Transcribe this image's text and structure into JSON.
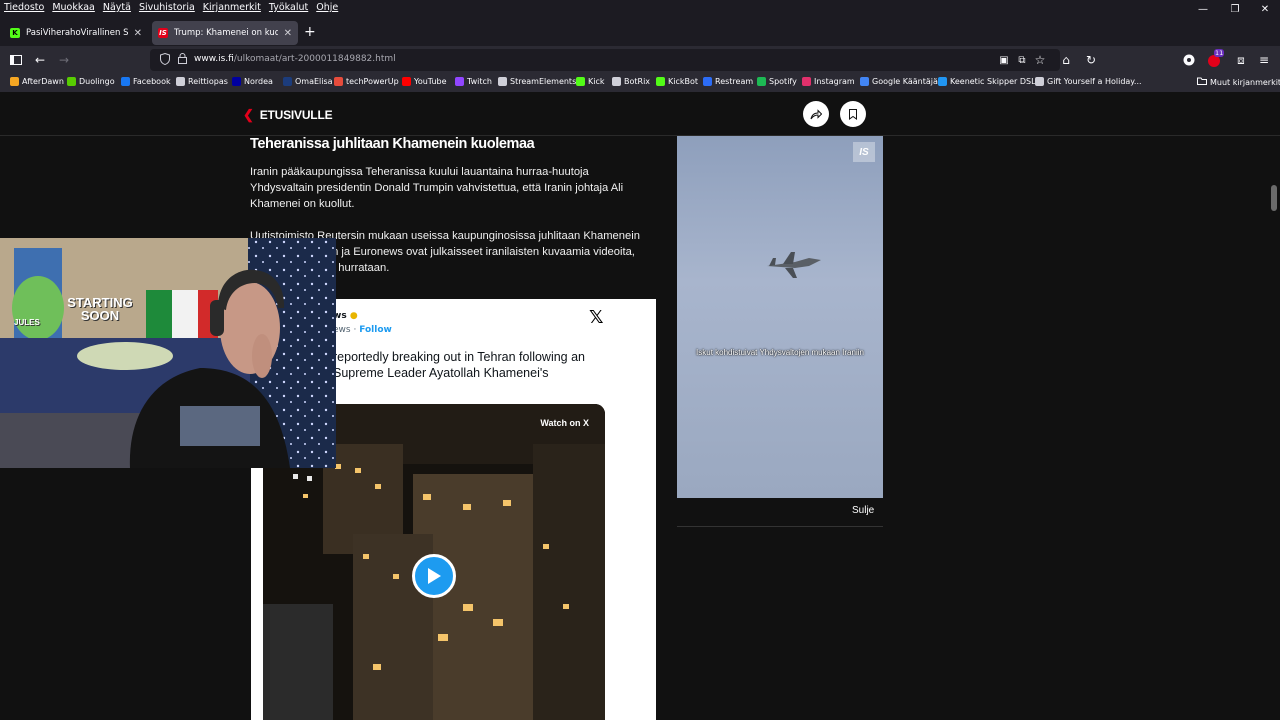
{
  "menu": [
    "Tiedosto",
    "Muokkaa",
    "Näytä",
    "Sivuhistoria",
    "Kirjanmerkit",
    "Työkalut",
    "Ohje"
  ],
  "tabs": [
    {
      "title": "PasiViherahoVirallinen Stream -",
      "favicon_color": "#53fc18"
    },
    {
      "title": "Trump: Khamenei on kuollut - IS",
      "favicon_color": "#e2001a",
      "favicon_text": "IS"
    }
  ],
  "url": {
    "host": "www.is.fi",
    "path": "/ulkomaat/art-2000011849882.html"
  },
  "bookmarks": [
    {
      "label": "AfterDawn",
      "color": "#f5a623"
    },
    {
      "label": "Duolingo",
      "color": "#58cc02"
    },
    {
      "label": "Facebook",
      "color": "#1877f2"
    },
    {
      "label": "Reittiopas",
      "color": "#cfcfd8"
    },
    {
      "label": "Nordea",
      "color": "#0000a0"
    },
    {
      "label": "OmaElisa",
      "color": "#1c3c7c"
    },
    {
      "label": "techPowerUp",
      "color": "#e74c3c"
    },
    {
      "label": "YouTube",
      "color": "#ff0000"
    },
    {
      "label": "Twitch",
      "color": "#9146ff"
    },
    {
      "label": "StreamElements",
      "color": "#cfcfd8"
    },
    {
      "label": "Kick",
      "color": "#53fc18"
    },
    {
      "label": "BotRix",
      "color": "#cfcfd8"
    },
    {
      "label": "KickBot",
      "color": "#53fc18"
    },
    {
      "label": "Restream",
      "color": "#2c6cf6"
    },
    {
      "label": "Spotify",
      "color": "#1db954"
    },
    {
      "label": "Instagram",
      "color": "#e1306c"
    },
    {
      "label": "Google Kääntäjä",
      "color": "#4285f4"
    },
    {
      "label": "Keenetic Skipper DSL",
      "color": "#2196f3"
    },
    {
      "label": "Gift Yourself a Holiday...",
      "color": "#cfcfd8"
    }
  ],
  "bookmarks_other": "Muut kirjanmerkit",
  "site": {
    "back_label": "ETUSIVULLE"
  },
  "article": {
    "heading": "Teheranissa juhlitaan Khamenein kuolemaa",
    "para1": "Iranin pääkaupungissa Teheranissa kuului lauantaina hurraa-huutoja Yhdysvaltain presidentin Donald Trumpin vahvistettua, että Iranin johtaja Ali Khamenei on kuollut.",
    "para2": "Uutistoimisto Reutersin mukaan useissa kaupunginosissa juhlitaan Khamenein kuolemaa. CNN:n ja Euronews ovat julkaisseet iranilaisten kuvaamia videoita, joissa kuolemalle hurrataan."
  },
  "tweet": {
    "account": "ws",
    "handle": "ews",
    "follow_label": "Follow",
    "text": "reportedly breaking out in Tehran following an Supreme Leader Ayatollah Khamenei's",
    "watch_label": "Watch on X"
  },
  "side_video": {
    "logo": "IS",
    "caption": "Iskut kohdistuivat Yhdysvaltojen mukaan Iraniin",
    "close_label": "Sulje"
  },
  "webcam": {
    "banner": "STARTING SOON",
    "tag": "JULES"
  },
  "notification_badge": "11"
}
